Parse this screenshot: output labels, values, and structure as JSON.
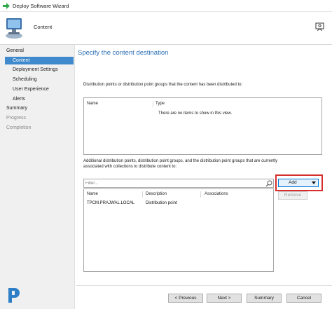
{
  "window": {
    "title": "Deploy Software Wizard"
  },
  "header": {
    "title": "Content"
  },
  "sidebar": {
    "items": [
      {
        "label": "General"
      },
      {
        "label": "Content"
      },
      {
        "label": "Deployment Settings"
      },
      {
        "label": "Scheduling"
      },
      {
        "label": "User Experience"
      },
      {
        "label": "Alerts"
      },
      {
        "label": "Summary"
      },
      {
        "label": "Progress"
      },
      {
        "label": "Completion"
      }
    ],
    "selected": "Content"
  },
  "main": {
    "title": "Specify the content destination",
    "distributed_label": "Distribution points or distribution point groups that the content has been distributed to:",
    "distributed_list": {
      "columns": [
        "Name",
        "Type"
      ],
      "empty_message": "There are no items to show in this view."
    },
    "additional_label_line1": "Additional distribution points, distribution point groups, and the distribution point groups that are currently",
    "additional_label_line2": "associated with collections to distribute content to:",
    "filter": {
      "placeholder": "Filter..."
    },
    "additional_list": {
      "columns": [
        "Name",
        "Description",
        "Associations"
      ],
      "rows": [
        {
          "name": "TPCM.PRAJWAL.LOCAL",
          "description": "Distribution point",
          "associations": ""
        }
      ]
    },
    "add_button": "Add",
    "remove_button": "Remove"
  },
  "footer": {
    "previous": "< Previous",
    "next": "Next >",
    "summary": "Summary",
    "cancel": "Cancel"
  },
  "colors": {
    "accent": "#3f89cd",
    "title_blue": "#2b6fb5",
    "highlight_red": "#d62d2d"
  }
}
